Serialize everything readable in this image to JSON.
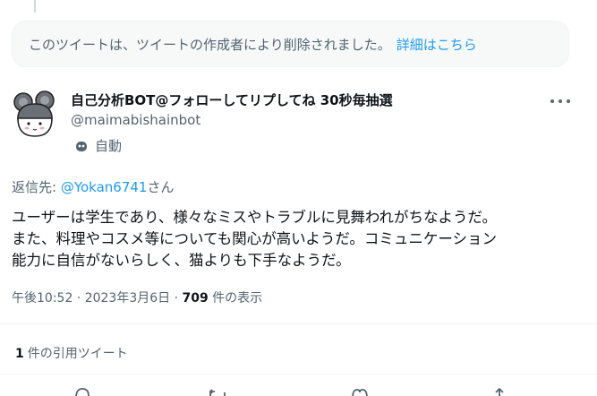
{
  "deleted_notice": {
    "text": "このツイートは、ツイートの作成者により削除されました。",
    "link": "詳細はこちら"
  },
  "author": {
    "display_name": "自己分析BOT@フォローしてリプしてね 30秒毎抽選",
    "handle": "@maimabishainbot",
    "automated_label": "自動"
  },
  "reply": {
    "prefix": "返信先: ",
    "mention": "@Yokan6741",
    "suffix": "さん"
  },
  "tweet": {
    "lines": [
      "ユーザーは学生であり、様々なミスやトラブルに見舞われがちなようだ。",
      "また、料理やコスメ等についても関心が高いようだ。コミュニケーション",
      "能力に自信がないらしく、猫よりも下手なようだ。"
    ]
  },
  "meta": {
    "timestamp": "午後10:52 · 2023年3月6日 · ",
    "views_count": "709",
    "views_label": " 件の表示"
  },
  "quotes": {
    "count": "1",
    "label": "件の引用ツイート"
  },
  "icons": {
    "more": "more-icon",
    "bot": "bot-icon",
    "avatar": "mouse-avatar",
    "reply": "reply-icon",
    "retweet": "retweet-icon",
    "like": "heart-icon",
    "share": "share-icon"
  },
  "colors": {
    "accent": "#1d9bf0",
    "text": "#0f1419",
    "muted": "#536471",
    "notice_bg": "#f7f9f9"
  }
}
